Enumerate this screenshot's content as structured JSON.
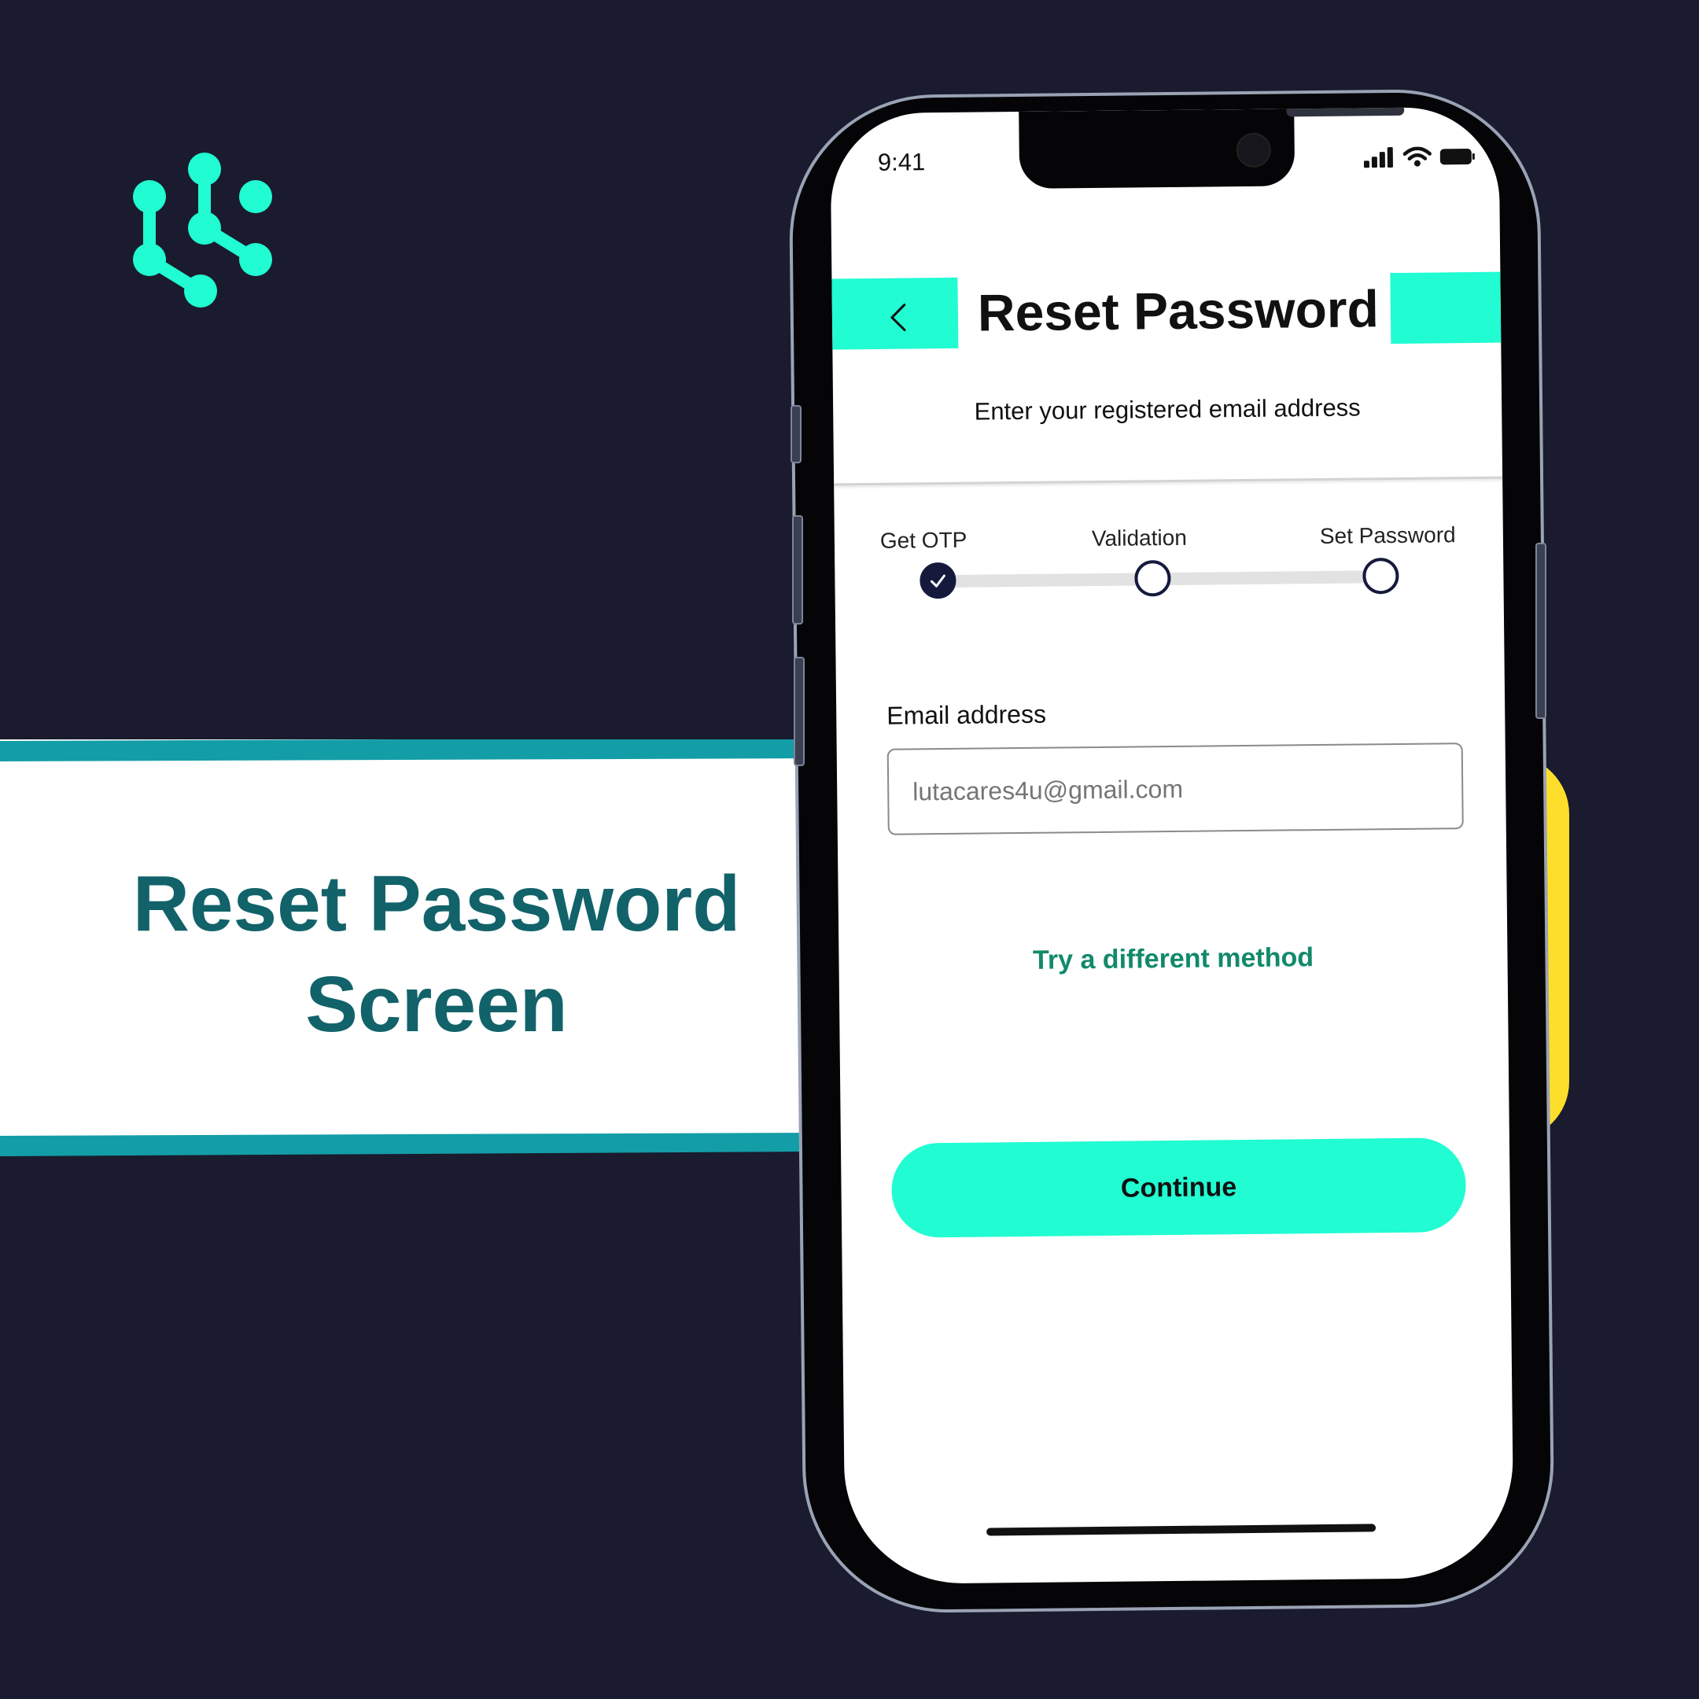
{
  "banner": {
    "title_line1": "Reset Password",
    "title_line2": "Screen"
  },
  "status_bar": {
    "time": "9:41"
  },
  "screen": {
    "title": "Reset Password",
    "subtitle": "Enter your registered email address",
    "steps": [
      {
        "label": "Get OTP",
        "done": true
      },
      {
        "label": "Validation",
        "done": false
      },
      {
        "label": "Set Password",
        "done": false
      }
    ],
    "email_label": "Email address",
    "email_placeholder": "lutacares4u@gmail.com",
    "alt_method_link": "Try a different method",
    "continue_label": "Continue"
  },
  "colors": {
    "background": "#1a1b2e",
    "accent": "#21fcd2",
    "banner_teal": "#12626a",
    "link": "#12896b",
    "step_dark": "#151a3d",
    "yellow": "#fddf2b"
  },
  "icons": {
    "logo": "network-logo-icon",
    "back": "chevron-left-icon",
    "check": "check-icon",
    "signal": "cellular-signal-icon",
    "wifi": "wifi-icon",
    "battery": "battery-icon"
  }
}
